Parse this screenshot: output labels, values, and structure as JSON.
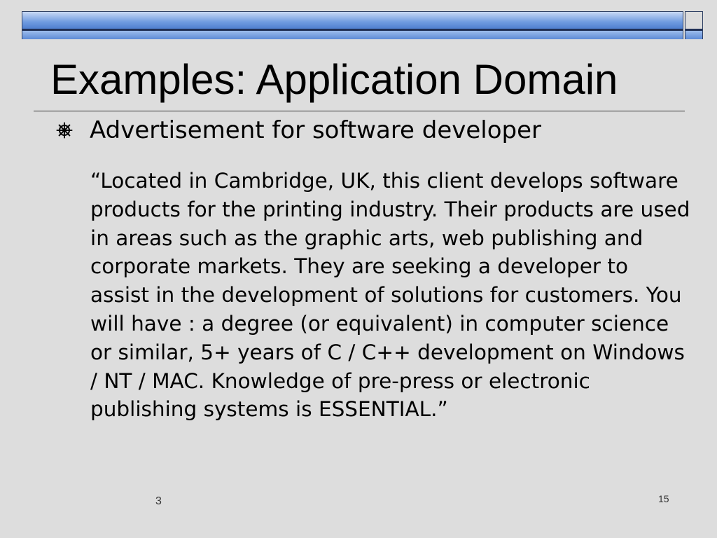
{
  "slide": {
    "title": "Examples: Application Domain",
    "bullet": "Advertisement for software developer",
    "bullet_icon": "ship-wheel-icon",
    "quote": "“Located in Cambridge, UK, this client develops software products for the printing industry. Their products are used in areas such as the graphic arts, web publishing and corporate markets. They are seeking a developer to assist in the development of solutions for customers. You will have : a degree (or equivalent) in computer science or similar, 5+ years of C / C++ development on Windows / NT / MAC. Knowledge of pre-press or electronic publishing systems is ESSENTIAL.”",
    "footer_left": "3",
    "page_number": "15"
  },
  "colors": {
    "background": "#dddddd",
    "bar_blue": "#6f9be0",
    "bar_dark": "#1f2f55"
  }
}
